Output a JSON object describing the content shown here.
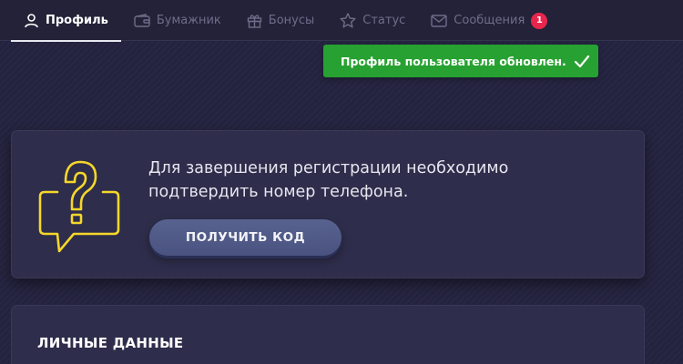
{
  "tabs": [
    {
      "label": "Профиль",
      "icon": "user-icon",
      "active": true
    },
    {
      "label": "Бумажник",
      "icon": "wallet-icon",
      "active": false
    },
    {
      "label": "Бонусы",
      "icon": "gift-icon",
      "active": false
    },
    {
      "label": "Статус",
      "icon": "star-icon",
      "active": false
    },
    {
      "label": "Сообщения",
      "icon": "envelope-icon",
      "active": false,
      "badge": "1"
    }
  ],
  "toast": {
    "message": "Профиль пользователя обновлен.",
    "icon": "checkmark-icon",
    "color": "#27a131"
  },
  "verification": {
    "text_line1": "Для завершения регистрации необходимо",
    "text_line2": "подтвердить номер телефона.",
    "button_label": "ПОЛУЧИТЬ КОД",
    "icon": "question-chat-icon",
    "icon_color": "#f5d72a"
  },
  "personal": {
    "title": "ЛИЧНЫЕ ДАННЫЕ"
  },
  "colors": {
    "background": "#24233f",
    "card": "#2e2d4b",
    "badge": "#e8264d",
    "button": "#525b89"
  }
}
